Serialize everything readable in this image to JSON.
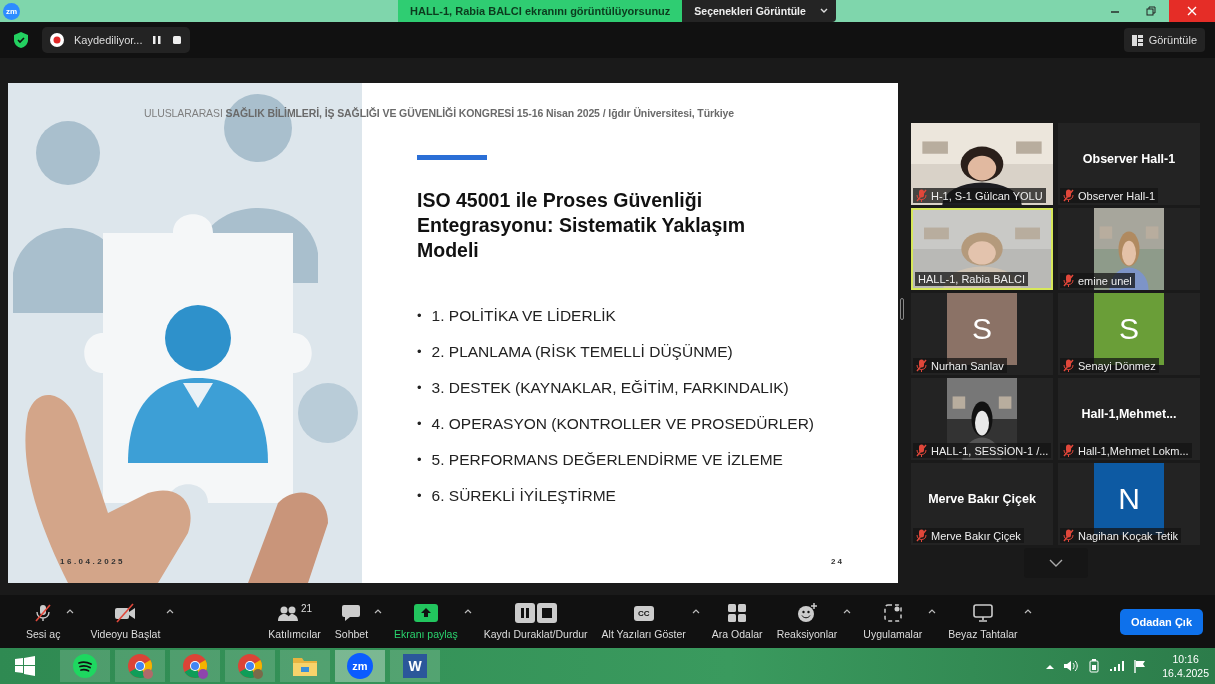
{
  "title_bar": {
    "logo": "zm",
    "share_notice": "HALL-1, Rabia BALCI ekranını görüntülüyorsunuz",
    "options_button": "Seçenekleri Görüntüle"
  },
  "meeting_bar": {
    "recording": "Kaydediliyor...",
    "view_button": "Görüntüle"
  },
  "slide": {
    "header": "ULUSLARARASI **SAĞLIK BİLİMLERİ, İŞ SAĞLIĞI VE GÜVENLİĞİ KONGRESİ 15-16 Nisan 2025 / Iğdır Üniversitesi, Türkiye**",
    "title": "ISO 45001 ile Proses Güvenliği Entegrasyonu: Sistematik Yaklaşım Modeli",
    "bullet_marker": "•",
    "bullets": [
      "1. POLİTİKA VE LİDERLİK",
      "2. PLANLAMA (RİSK TEMELLİ DÜŞÜNME)",
      "3. DESTEK (KAYNAKLAR, EĞİTİM, FARKINDALIK)",
      "4. OPERASYON (KONTROLLER VE PROSEDÜRLER)",
      "5. PERFORMANS DEĞERLENDİRME VE İZLEME",
      "6. SÜREKLİ İYİLEŞTİRME"
    ],
    "date": "16.04.2025",
    "page": "24"
  },
  "participants": [
    {
      "kind": "video",
      "label": "H-1, S-1 Gülcan YOLU",
      "muted": true,
      "speaking": false
    },
    {
      "kind": "name",
      "display_name": "Observer Hall-1",
      "label": "Observer Hall-1",
      "muted": true,
      "speaking": false
    },
    {
      "kind": "video",
      "label": "HALL-1, Rabia BALCI",
      "muted": false,
      "speaking": true
    },
    {
      "label": "emine unel",
      "muted": true,
      "speaking": false
    },
    {
      "kind": "avatar",
      "initial": "S",
      "color": "#8b7266",
      "label": "Nurhan Sanlav",
      "muted": true,
      "speaking": false
    },
    {
      "kind": "avatar",
      "initial": "S",
      "color": "#6a9e38",
      "label": "Senayi Dönmez",
      "muted": true,
      "speaking": false
    },
    {
      "label": "HALL-1, SESSİON-1  /...",
      "muted": true,
      "speaking": false
    },
    {
      "kind": "name",
      "display_name": "Hall-1,Mehmet...",
      "label": "Hall-1,Mehmet Lokm...",
      "muted": true,
      "speaking": false
    },
    {
      "kind": "name",
      "display_name": "Merve Bakır Çiçek",
      "label": "Merve Bakır Çiçek",
      "muted": true,
      "speaking": false
    },
    {
      "kind": "avatar",
      "initial": "N",
      "color": "#0d5aa3",
      "label": "Nagihan Koçak Tetik",
      "muted": true,
      "speaking": false
    }
  ],
  "toolbar": {
    "items": [
      {
        "kind": "mic",
        "label": "Sesi aç",
        "caret": true
      },
      {
        "kind": "camera",
        "label": "Videoyu Başlat",
        "caret": true
      },
      {
        "kind": "people",
        "label": "Katılımcılar",
        "count": "21",
        "caret": false
      },
      {
        "kind": "chat",
        "label": "Sohbet",
        "caret": true
      },
      {
        "kind": "share",
        "label": "Ekranı paylaş",
        "caret": true
      },
      {
        "kind": "record",
        "label": "Kaydı Duraklat/Durdur",
        "caret": false
      },
      {
        "kind": "cc",
        "label": "Alt Yazıları Göster",
        "badge": "CC",
        "caret": true
      },
      {
        "kind": "rooms",
        "label": "Ara Odalar",
        "caret": false
      },
      {
        "kind": "reactions",
        "label": "Reaksiyonlar",
        "caret": true
      },
      {
        "kind": "apps",
        "label": "Uygulamalar",
        "caret": true
      },
      {
        "kind": "whiteboard",
        "label": "Beyaz Tahtalar",
        "caret": true
      }
    ],
    "leave_button": "Odadan Çık"
  },
  "taskbar": {
    "apps": [
      {
        "kind": "music",
        "selected": false
      },
      {
        "kind": "browser",
        "selected": false
      },
      {
        "kind": "browser",
        "selected": false
      },
      {
        "kind": "browser",
        "selected": false
      },
      {
        "kind": "folder",
        "selected": false
      },
      {
        "kind": "zoom",
        "text": "zm",
        "selected": true
      },
      {
        "kind": "word",
        "text": "W",
        "selected": false
      }
    ],
    "time": "10:16",
    "date": "16.4.2025"
  }
}
